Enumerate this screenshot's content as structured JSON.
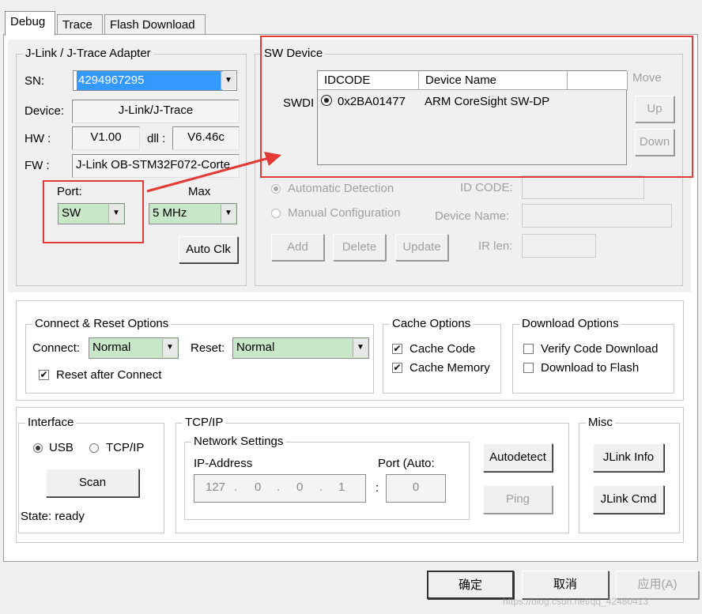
{
  "tabs": [
    "Debug",
    "Trace",
    "Flash Download"
  ],
  "adapter": {
    "title": "J-Link / J-Trace Adapter",
    "sn_label": "SN:",
    "sn_value": "4294967295",
    "device_label": "Device:",
    "device_value": "J-Link/J-Trace",
    "hw_label": "HW :",
    "hw_value": "V1.00",
    "dll_label": "dll :",
    "dll_value": "V6.46c",
    "fw_label": "FW :",
    "fw_value": "J-Link OB-STM32F072-Corte",
    "port_label": "Port:",
    "port_value": "SW",
    "max_label": "Max",
    "max_value": "5 MHz",
    "autoclk": "Auto Clk"
  },
  "sw_device": {
    "title": "SW Device",
    "row_label": "SWDI",
    "col_idcode": "IDCODE",
    "col_device": "Device Name",
    "rows": [
      {
        "idcode": "0x2BA01477",
        "device": "ARM CoreSight SW-DP"
      }
    ],
    "move_label": "Move",
    "up": "Up",
    "down": "Down",
    "auto_detect": "Automatic Detection",
    "manual_config": "Manual Configuration",
    "id_code_label": "ID CODE:",
    "device_name_label": "Device Name:",
    "ir_len_label": "IR len:",
    "add": "Add",
    "delete": "Delete",
    "update": "Update"
  },
  "connect_reset": {
    "title": "Connect & Reset Options",
    "connect_label": "Connect:",
    "connect_value": "Normal",
    "reset_label": "Reset:",
    "reset_value": "Normal",
    "reset_after_connect": "Reset after Connect",
    "reset_after_connect_checked": true
  },
  "cache": {
    "title": "Cache Options",
    "cache_code": "Cache Code",
    "cache_memory": "Cache Memory",
    "cache_code_checked": true,
    "cache_memory_checked": true
  },
  "download": {
    "title": "Download Options",
    "verify": "Verify Code Download",
    "to_flash": "Download to Flash"
  },
  "interface": {
    "title": "Interface",
    "usb": "USB",
    "tcpip": "TCP/IP",
    "scan": "Scan",
    "state": "State: ready"
  },
  "tcp": {
    "title": "TCP/IP",
    "network": "Network Settings",
    "ip_label": "IP-Address",
    "port_label": "Port (Auto:",
    "ip": [
      "127",
      "0",
      "0",
      "1"
    ],
    "port": "0",
    "autodetect": "Autodetect",
    "ping": "Ping"
  },
  "misc": {
    "title": "Misc",
    "jlink_info": "JLink Info",
    "jlink_cmd": "JLink Cmd"
  },
  "footer": {
    "ok": "确定",
    "cancel": "取消",
    "apply": "应用(A)",
    "watermark": "https://blog.csdn.net/qq_42480413"
  },
  "colors": {
    "highlight": "#e53935",
    "combo_bg": "#c8e6c8",
    "selection": "#3399ff"
  }
}
